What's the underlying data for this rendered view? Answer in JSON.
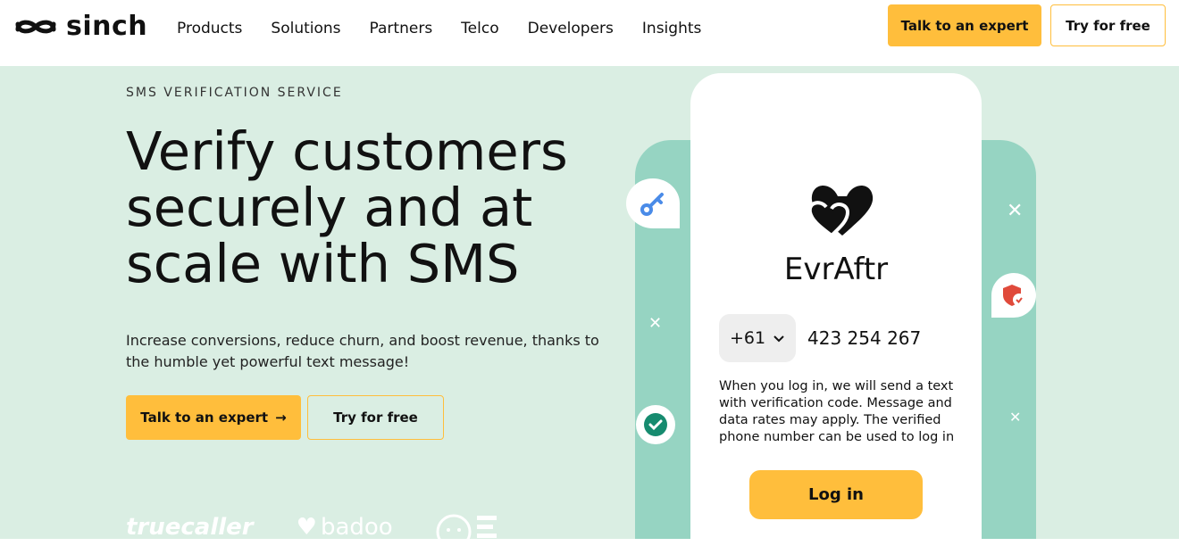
{
  "header": {
    "logo_text": "sinch",
    "nav": [
      "Products",
      "Solutions",
      "Partners",
      "Telco",
      "Developers",
      "Insights"
    ],
    "cta_expert": "Talk to an expert",
    "cta_free": "Try for free"
  },
  "hero": {
    "eyebrow": "SMS VERIFICATION SERVICE",
    "headline": "Verify customers securely and at scale with SMS",
    "subtext": "Increase conversions, reduce churn, and boost revenue, thanks to the humble yet powerful text message!",
    "cta_expert": "Talk to an expert",
    "cta_free": "Try for free",
    "logos": [
      "truecaller",
      "badoo"
    ]
  },
  "phone": {
    "brand": "EvrAftr",
    "country_code": "+61",
    "number": "423 254 267",
    "disclaimer": "When you log in, we will send a text with verification code. Message and data rates may apply. The verified phone number can be used to log in",
    "login": "Log in"
  },
  "colors": {
    "accent": "#ffbe3c",
    "hero_bg": "#daeee3",
    "teal": "#96d4c2"
  }
}
